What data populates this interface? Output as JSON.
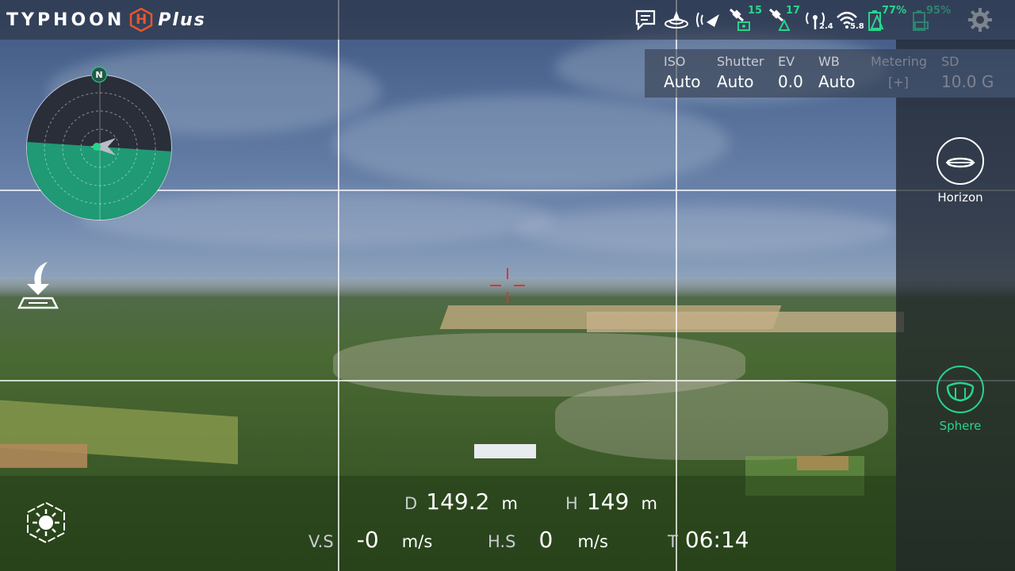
{
  "app": {
    "brand": "TYPHOON",
    "brand_badge": "H",
    "brand_suffix": "Plus"
  },
  "status_bar": {
    "gps_drone_count": "15",
    "gps_controller_count": "17",
    "rc_band": "2.4",
    "wifi_band": "5.8",
    "controller_battery": "77%",
    "drone_battery": "95%",
    "icons": [
      "message-icon",
      "ground-station-icon",
      "signal-bars-icon",
      "gps-satellite-drone-icon",
      "gps-satellite-controller-icon",
      "antenna-icon",
      "wifi-icon",
      "controller-battery-icon",
      "drone-battery-icon",
      "settings-gear-icon"
    ]
  },
  "camera_settings": {
    "iso_label": "ISO",
    "iso_value": "Auto",
    "shutter_label": "Shutter",
    "shutter_value": "Auto",
    "ev_label": "EV",
    "ev_value": "0.0",
    "wb_label": "WB",
    "wb_value": "Auto",
    "metering_label": "Metering",
    "metering_value": "[+]",
    "sd_label": "SD",
    "sd_value": "10.0 G"
  },
  "right_panel": {
    "horizon_label": "Horizon",
    "sphere_label": "Sphere",
    "active_mode": "Sphere"
  },
  "compass": {
    "north_label": "N"
  },
  "telemetry": {
    "distance_label": "D",
    "distance_value": "149.2",
    "distance_unit": "m",
    "height_label": "H",
    "height_value": "149",
    "height_unit": "m",
    "vs_label": "V.S",
    "vs_value": "-0",
    "vs_unit": "m/s",
    "hs_label": "H.S",
    "hs_value": "0",
    "hs_unit": "m/s",
    "time_label": "T",
    "time_value": "06:14"
  },
  "colors": {
    "accent_green": "#27d58c",
    "logo_orange": "#e8552a",
    "crosshair_red": "#e0303a"
  }
}
